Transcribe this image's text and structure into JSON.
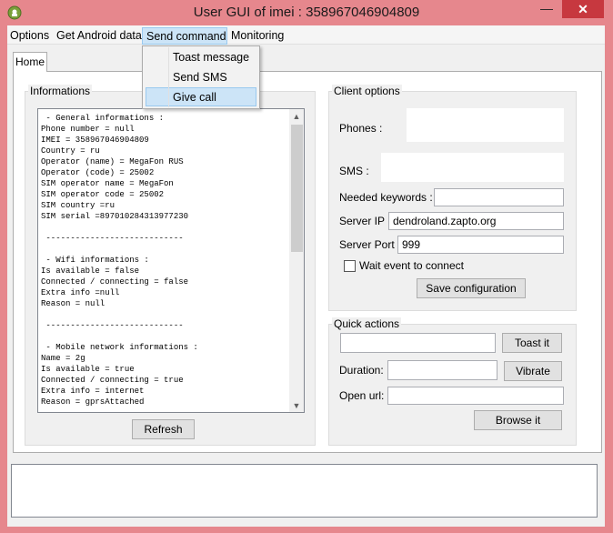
{
  "window": {
    "title": "User GUI of imei : 358967046904809",
    "minimize_glyph": "—",
    "close_glyph": "✕"
  },
  "menu": {
    "items": [
      "Options",
      "Get Android data",
      "Send command",
      "Monitoring"
    ],
    "dropdown": [
      "Toast message",
      "Send SMS",
      "Give call"
    ]
  },
  "tabs": [
    "Home"
  ],
  "informations": {
    "title": "Informations",
    "lines": [
      " - General informations :",
      "Phone number = null",
      "IMEI = 358967046904809",
      "Country = ru",
      "Operator (name) = MegaFon RUS",
      "Operator (code) = 25002",
      "SIM operator name = MegaFon",
      "SIM operator code = 25002",
      "SIM country =ru",
      "SIM serial =897010284313977230",
      "",
      " ----------------------------",
      "",
      " - Wifi informations :",
      "Is available = false",
      "Connected / connecting = false",
      "Extra info =null",
      "Reason = null",
      "",
      " ----------------------------",
      "",
      " - Mobile network informations :",
      "Name = 2g",
      "Is available = true",
      "Connected / connecting = true",
      "Extra info = internet",
      "Reason = gprsAttached"
    ],
    "refresh_label": "Refresh"
  },
  "client_options": {
    "title": "Client options",
    "phones_label": "Phones :",
    "sms_label": "SMS :",
    "keywords_label": "Needed keywords :",
    "keywords_value": "",
    "server_ip_label": "Server IP :",
    "server_ip_value": "dendroland.zapto.org",
    "server_port_label": "Server Port :",
    "server_port_value": "999",
    "wait_event_label": "Wait event to connect",
    "save_label": "Save configuration"
  },
  "quick_actions": {
    "title": "Quick actions",
    "toast_value": "",
    "toast_label": "Toast it",
    "duration_label": "Duration:",
    "duration_value": "",
    "vibrate_label": "Vibrate",
    "open_url_label": "Open url:",
    "open_url_value": "",
    "browse_label": "Browse it"
  },
  "colors": {
    "title_bar": "#e6878d",
    "close_button": "#c7383f",
    "highlight": "#cce4f7"
  }
}
